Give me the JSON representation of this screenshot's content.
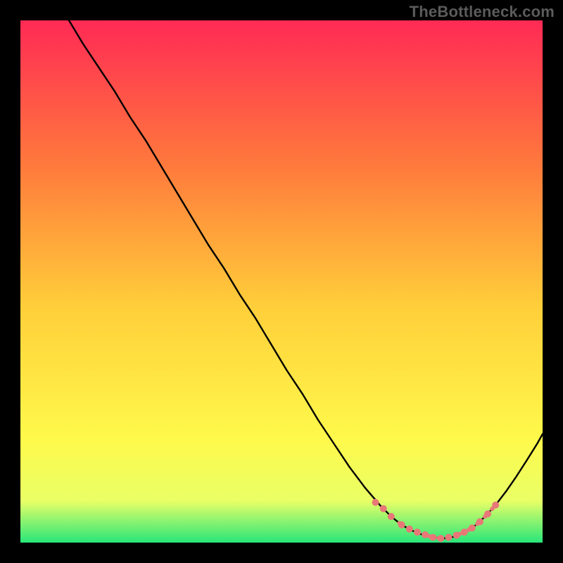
{
  "watermark": {
    "text": "TheBottleneck.com"
  },
  "colors": {
    "bg": "#000000",
    "gradient_top": "#ff2a55",
    "gradient_mid1": "#ff7a3c",
    "gradient_mid2": "#ffcf3a",
    "gradient_mid3": "#fff94b",
    "gradient_mid4": "#e9ff66",
    "gradient_bot": "#28e67a",
    "curve": "#000000",
    "marker": "#e87878"
  },
  "chart_data": {
    "type": "line",
    "title": "",
    "xlabel": "",
    "ylabel": "",
    "xlim": [
      0,
      100
    ],
    "ylim": [
      0,
      100
    ],
    "series": [
      {
        "name": "curve",
        "x": [
          0,
          3,
          6,
          9,
          12,
          15,
          18,
          21,
          24,
          27,
          30,
          33,
          36,
          39,
          42,
          45,
          48,
          51,
          54,
          57,
          60,
          63,
          66,
          69,
          71,
          73,
          75,
          77,
          79,
          81,
          83,
          85,
          87,
          89,
          91,
          93,
          95,
          97,
          99,
          100
        ],
        "y": [
          114,
          110,
          105.5,
          100.5,
          95.5,
          91,
          86.5,
          81.5,
          77,
          72,
          67,
          62,
          57,
          52.5,
          47.5,
          43,
          38,
          33,
          28.5,
          23.5,
          19,
          14.5,
          10.5,
          7,
          5,
          3.4,
          2.3,
          1.5,
          1,
          0.8,
          1.1,
          2,
          3.2,
          5,
          7.2,
          9.8,
          12.7,
          15.8,
          19,
          20.8
        ]
      }
    ],
    "markers": {
      "name": "highlight-points",
      "x": [
        68,
        69.5,
        71,
        73,
        74.5,
        76,
        77.5,
        79,
        80.5,
        82,
        83.5,
        85,
        86.5,
        88,
        89.5,
        91
      ],
      "y": [
        7.7,
        6.5,
        5,
        3.4,
        2.6,
        2,
        1.5,
        1,
        0.8,
        1,
        1.4,
        2,
        2.8,
        4,
        5.5,
        7.2
      ]
    }
  }
}
